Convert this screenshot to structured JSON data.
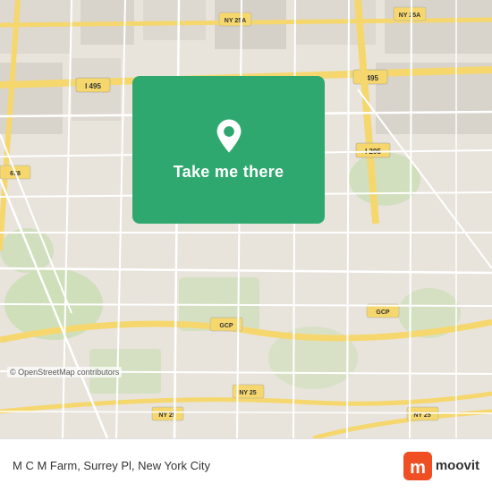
{
  "map": {
    "copyright": "© OpenStreetMap contributors",
    "background_color": "#e8e4dc"
  },
  "card": {
    "button_label": "Take me there",
    "pin_color": "white"
  },
  "bottom_bar": {
    "location_text": "M C M Farm, Surrey Pl, New York City",
    "brand_name": "moovit"
  },
  "roads": {
    "highway_color": "#f5d76e",
    "road_color": "#ffffff",
    "minor_road_color": "#f0ece4"
  }
}
